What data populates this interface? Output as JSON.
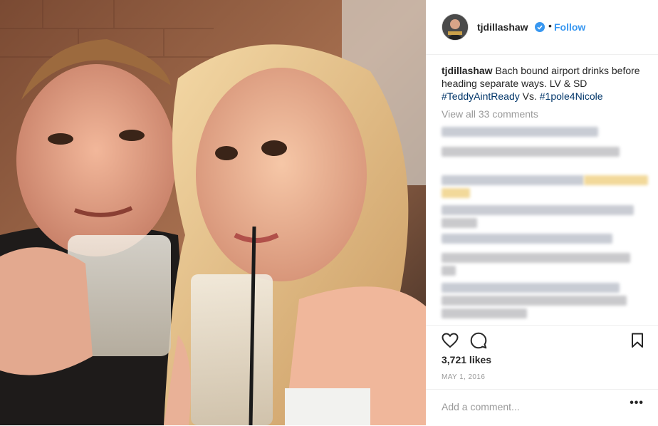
{
  "post": {
    "photo_alt": "selfie of a man and a woman holding drinks"
  },
  "header": {
    "username": "tjdillashaw",
    "separator": "•",
    "follow_label": "Follow"
  },
  "caption": {
    "username": "tjdillashaw",
    "text": " Bach bound airport drinks before heading separate ways. LV & SD ",
    "hashtag1": "#TeddyAintReady",
    "middle": " Vs. ",
    "hashtag2": "#1pole4Nicole"
  },
  "comments": {
    "view_all": "View all 33 comments"
  },
  "footer": {
    "likes": "3,721 likes",
    "date": "MAY 1, 2016",
    "add_comment_placeholder": "Add a comment...",
    "more_label": "•••"
  },
  "colors": {
    "link": "#3897f0",
    "hashtag": "#003569",
    "muted": "#999999",
    "text": "#262626"
  }
}
